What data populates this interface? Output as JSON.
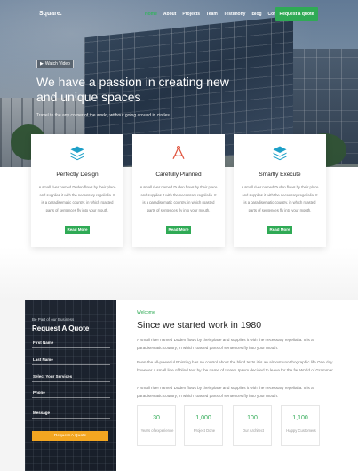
{
  "nav": {
    "logo": "Square.",
    "items": [
      "Home",
      "About",
      "Projects",
      "Team",
      "Testimony",
      "Blog",
      "Contact"
    ],
    "active_index": 0,
    "cta": "Request a quote"
  },
  "hero": {
    "watch_video": "Watch Video",
    "title": "We have a passion in creating new and unique spaces",
    "subtitle": "Travel to the any corner of the world, without going around in circles"
  },
  "features": [
    {
      "icon": "layers-icon",
      "title": "Perfectly Design",
      "text": "A small river named Duden flows by their place and supplies it with the necessary regelialia. It is a paradisematic country, in which roasted parts of sentences fly into your mouth.",
      "button": "Read More"
    },
    {
      "icon": "drafting-compass-icon",
      "title": "Carefully Planned",
      "text": "A small river named Duden flows by their place and supplies it with the necessary regelialia. It is a paradisematic country, in which roasted parts of sentences fly into your mouth.",
      "button": "Read More"
    },
    {
      "icon": "layers-icon",
      "title": "Smartly Execute",
      "text": "A small river named Duden flows by their place and supplies it with the necessary regelialia. It is a paradisematic country, in which roasted parts of sentences fly into your mouth.",
      "button": "Read More"
    }
  ],
  "quote_form": {
    "kicker": "Be Part of our Business",
    "title": "Request A Quote",
    "fields": [
      "First Name",
      "Last Name",
      "Select Your Services",
      "Phone",
      "Message"
    ],
    "submit": "Request A Quote"
  },
  "about": {
    "kicker": "Welcome",
    "title": "Since we started work in 1980",
    "paragraphs": [
      "A small river named Duden flows by their place and supplies it with the necessary regelialia. It is a paradisematic country, in which roasted parts of sentences fly into your mouth.",
      "Even the all-powerful Pointing has no control about the blind texts it is an almost unorthographic life One day however a small line of blind text by the name of Lorem Ipsum decided to leave for the far World of Grammar.",
      "A small river named Duden flows by their place and supplies it with the necessary regelialia. It is a paradisematic country, in which roasted parts of sentences fly into your mouth."
    ],
    "stats": [
      {
        "number": "30",
        "label": "Years of experience"
      },
      {
        "number": "1,000",
        "label": "Project Done"
      },
      {
        "number": "100",
        "label": "Our Architect"
      },
      {
        "number": "1,100",
        "label": "Happy Customers"
      }
    ]
  },
  "colors": {
    "accent": "#2faa55",
    "quote_button": "#f3a621"
  }
}
